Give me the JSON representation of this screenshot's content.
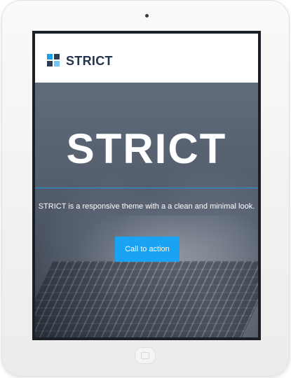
{
  "navbar": {
    "brand": "STRICT",
    "logo_icon": "grid-logo-icon",
    "logo_colors": [
      "#1b9de8",
      "#2a3d55",
      "#2a3d55",
      "#6ec6f5"
    ]
  },
  "hero": {
    "title": "STRICT",
    "tagline": "STRICT is a responsive theme with a a clean and minimal look.",
    "cta_label": "Call to action",
    "scroll_icon": "chevron-down-icon"
  },
  "colors": {
    "accent": "#1aa3f2",
    "brand_text": "#22354d",
    "divider": "#1e9be0"
  }
}
